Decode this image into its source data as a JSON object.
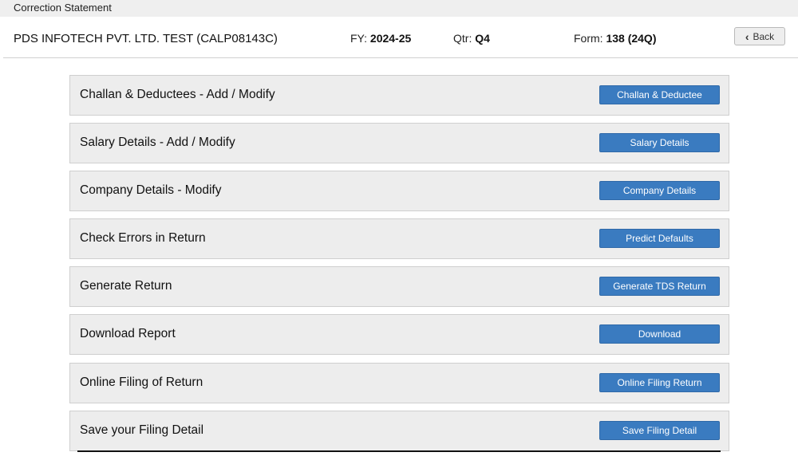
{
  "window": {
    "title": "Correction Statement"
  },
  "header": {
    "company": "PDS INFOTECH PVT. LTD. TEST (CALP08143C)",
    "fy_label": "FY:",
    "fy_value": "2024-25",
    "qtr_label": "Qtr:",
    "qtr_value": "Q4",
    "form_label": "Form:",
    "form_value": "138 (24Q)",
    "back_label": "Back"
  },
  "rows": [
    {
      "label": "Challan & Deductees - Add / Modify",
      "button": "Challan & Deductee"
    },
    {
      "label": "Salary Details - Add / Modify",
      "button": "Salary Details"
    },
    {
      "label": "Company Details - Modify",
      "button": "Company Details"
    },
    {
      "label": "Check Errors in Return",
      "button": "Predict Defaults"
    },
    {
      "label": "Generate Return",
      "button": "Generate TDS Return"
    },
    {
      "label": "Download Report",
      "button": "Download"
    },
    {
      "label": "Online Filing of Return",
      "button": "Online Filing Return"
    },
    {
      "label": "Save your Filing Detail",
      "button": "Save Filing Detail"
    }
  ],
  "colors": {
    "accent": "#3a7bc0",
    "row_bg": "#ededed"
  }
}
